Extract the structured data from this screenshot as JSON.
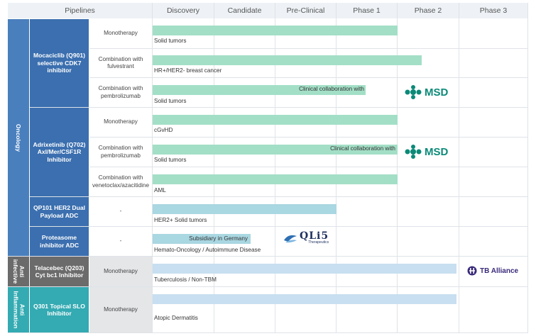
{
  "header": {
    "pipelines": "Pipelines",
    "stages": [
      "Discovery",
      "Candidate",
      "Pre-Clinical",
      "Phase 1",
      "Phase 2",
      "Phase 3"
    ]
  },
  "areas": [
    "Oncology",
    "Anti infective",
    "Anti Inflammation"
  ],
  "drugs": [
    "Mocaciclib (Q901) selective CDK7 inhibitor",
    "Adrixetinib (Q702) Axl/Mer/CSF1R Inhibitor",
    "QP101 HER2 Dual Payload ADC",
    "Proteasome inhibitor ADC",
    "Telacebec (Q203) Cyt bc1 Inhibitor",
    "Q301 Topical SLO Inhibitor"
  ],
  "rows": [
    {
      "strategy": "Monotherapy",
      "indication": "Solid tumors",
      "progress_stage": 4.0
    },
    {
      "strategy": "Combination with fulvestrant",
      "indication": "HR+/HER2- breast cancer",
      "progress_stage": 4.4
    },
    {
      "strategy": "Combination with pembrolizumab",
      "indication": "Solid tumors",
      "progress_stage": 3.48,
      "note": "Clinical collaboration with",
      "partner": "MSD"
    },
    {
      "strategy": "Monotherapy",
      "indication": "cGvHD",
      "progress_stage": 4.0
    },
    {
      "strategy": "Combination with pembrolizumab",
      "indication": "Solid tumors",
      "progress_stage": 4.0,
      "note": "Clinical collaboration with",
      "partner": "MSD"
    },
    {
      "strategy": "Combination with venetoclax/azacitidine",
      "indication": "AML",
      "progress_stage": 4.0
    },
    {
      "strategy": "-",
      "indication": "HER2+ Solid tumors",
      "progress_stage": 3.0
    },
    {
      "strategy": "-",
      "indication": "Hemato-Oncology / Autoimmune Disease",
      "progress_stage": 1.6,
      "note": "Subsidiary in Germany",
      "partner": "QLi5",
      "partner_sub": "Therapeutics"
    },
    {
      "strategy": "Monotherapy",
      "indication": "Tuberculosis / Non-TBM",
      "progress_stage": 5.0,
      "partner": "TB Alliance"
    },
    {
      "strategy": "Monotherapy",
      "indication": "Atopic Dermatitis",
      "progress_stage": 5.0
    }
  ],
  "colors": {
    "oncology": "#4a7fbd",
    "drug_oncology": "#3b6faf",
    "anti_infective": "#6b6b6b",
    "anti_inflammation": "#34aab2",
    "bar_green": "#a3dfc7",
    "bar_blue": "#a9d7e2",
    "bar_light": "#c7dff0",
    "msd": "#0b8a78",
    "tb": "#3a2a7a"
  }
}
